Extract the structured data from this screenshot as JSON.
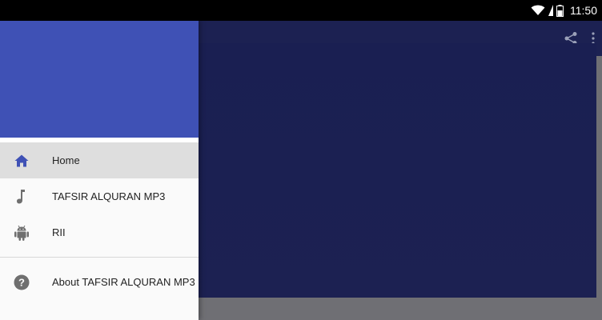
{
  "status_bar": {
    "time": "11:50"
  },
  "drawer": {
    "items": [
      {
        "label": "Home",
        "icon": "home-icon",
        "active": true
      },
      {
        "label": "TAFSIR ALQURAN MP3",
        "icon": "music-note-icon"
      },
      {
        "label": "RII",
        "icon": "android-icon"
      }
    ],
    "footer_items": [
      {
        "label": "About TAFSIR ALQURAN MP3",
        "icon": "help-icon"
      }
    ]
  },
  "colors": {
    "drawer_header": "#3f51b5",
    "toolbar": "#1c2152",
    "active_icon": "#3f51b5"
  }
}
